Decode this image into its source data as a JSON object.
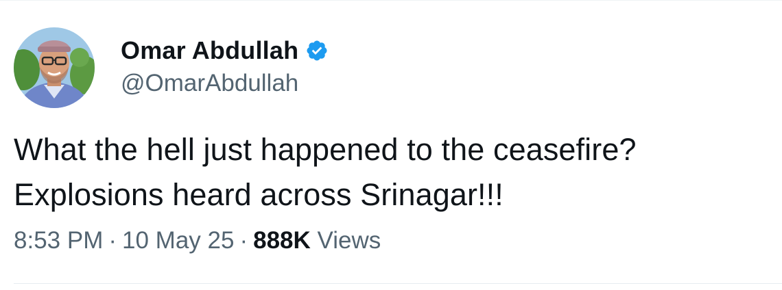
{
  "author": {
    "display_name": "Omar Abdullah",
    "handle": "@OmarAbdullah",
    "verified": true,
    "badge_color": "#1d9bf0"
  },
  "tweet": {
    "text_lines": [
      "What the hell just happened to the ceasefire?",
      "Explosions heard across Srinagar!!!"
    ]
  },
  "meta": {
    "time": "8:53 PM",
    "separator": "·",
    "date": "10 May 25",
    "views_count": "888K",
    "views_label": "Views"
  },
  "colors": {
    "text_primary": "#0f1419",
    "text_secondary": "#536471",
    "divider": "#eff3f4"
  }
}
